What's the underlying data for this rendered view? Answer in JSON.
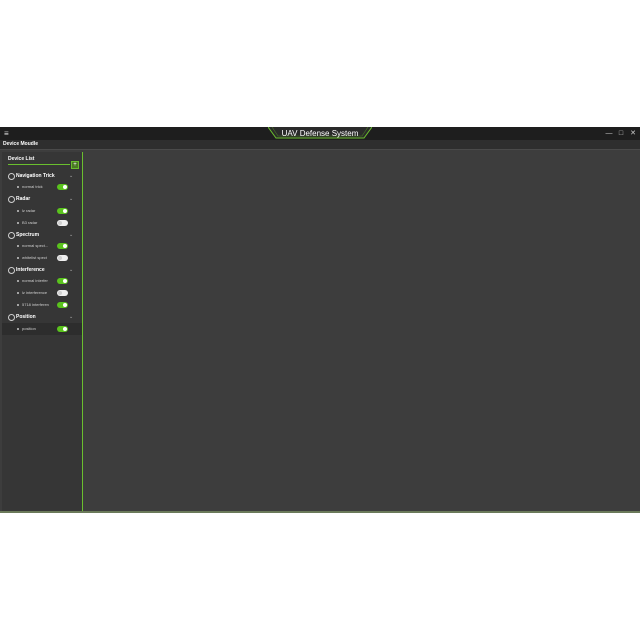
{
  "window": {
    "title": "UAV Defense System",
    "controls": [
      "—",
      "□",
      "✕"
    ]
  },
  "module_bar": {
    "title": "Device Moudle"
  },
  "device_list": {
    "title": "Device List",
    "add_label": "+",
    "groups": [
      {
        "label": "Navigation Trick",
        "icon": "navigation-icon",
        "items": [
          {
            "label": "normal trick",
            "enabled": true
          }
        ]
      },
      {
        "label": "Radar",
        "icon": "radar-icon",
        "items": [
          {
            "label": "lz radar",
            "enabled": true
          },
          {
            "label": "B3 radar",
            "enabled": false
          }
        ]
      },
      {
        "label": "Spectrum",
        "icon": "spectrum-icon",
        "items": [
          {
            "label": "normal spect...",
            "enabled": true
          },
          {
            "label": "whitelist spect",
            "enabled": false
          }
        ]
      },
      {
        "label": "Interference",
        "icon": "interference-icon",
        "items": [
          {
            "label": "normal interfer",
            "enabled": true
          },
          {
            "label": "lz interference",
            "enabled": false
          },
          {
            "label": "5718 interferen",
            "enabled": true
          }
        ]
      },
      {
        "label": "Position",
        "icon": "position-icon",
        "items": [
          {
            "label": "position",
            "enabled": true,
            "selected": true
          }
        ]
      }
    ]
  },
  "colors": {
    "accent": "#6abf2e",
    "toggle_on": "#5ac31d",
    "background": "#3d3d3d"
  }
}
